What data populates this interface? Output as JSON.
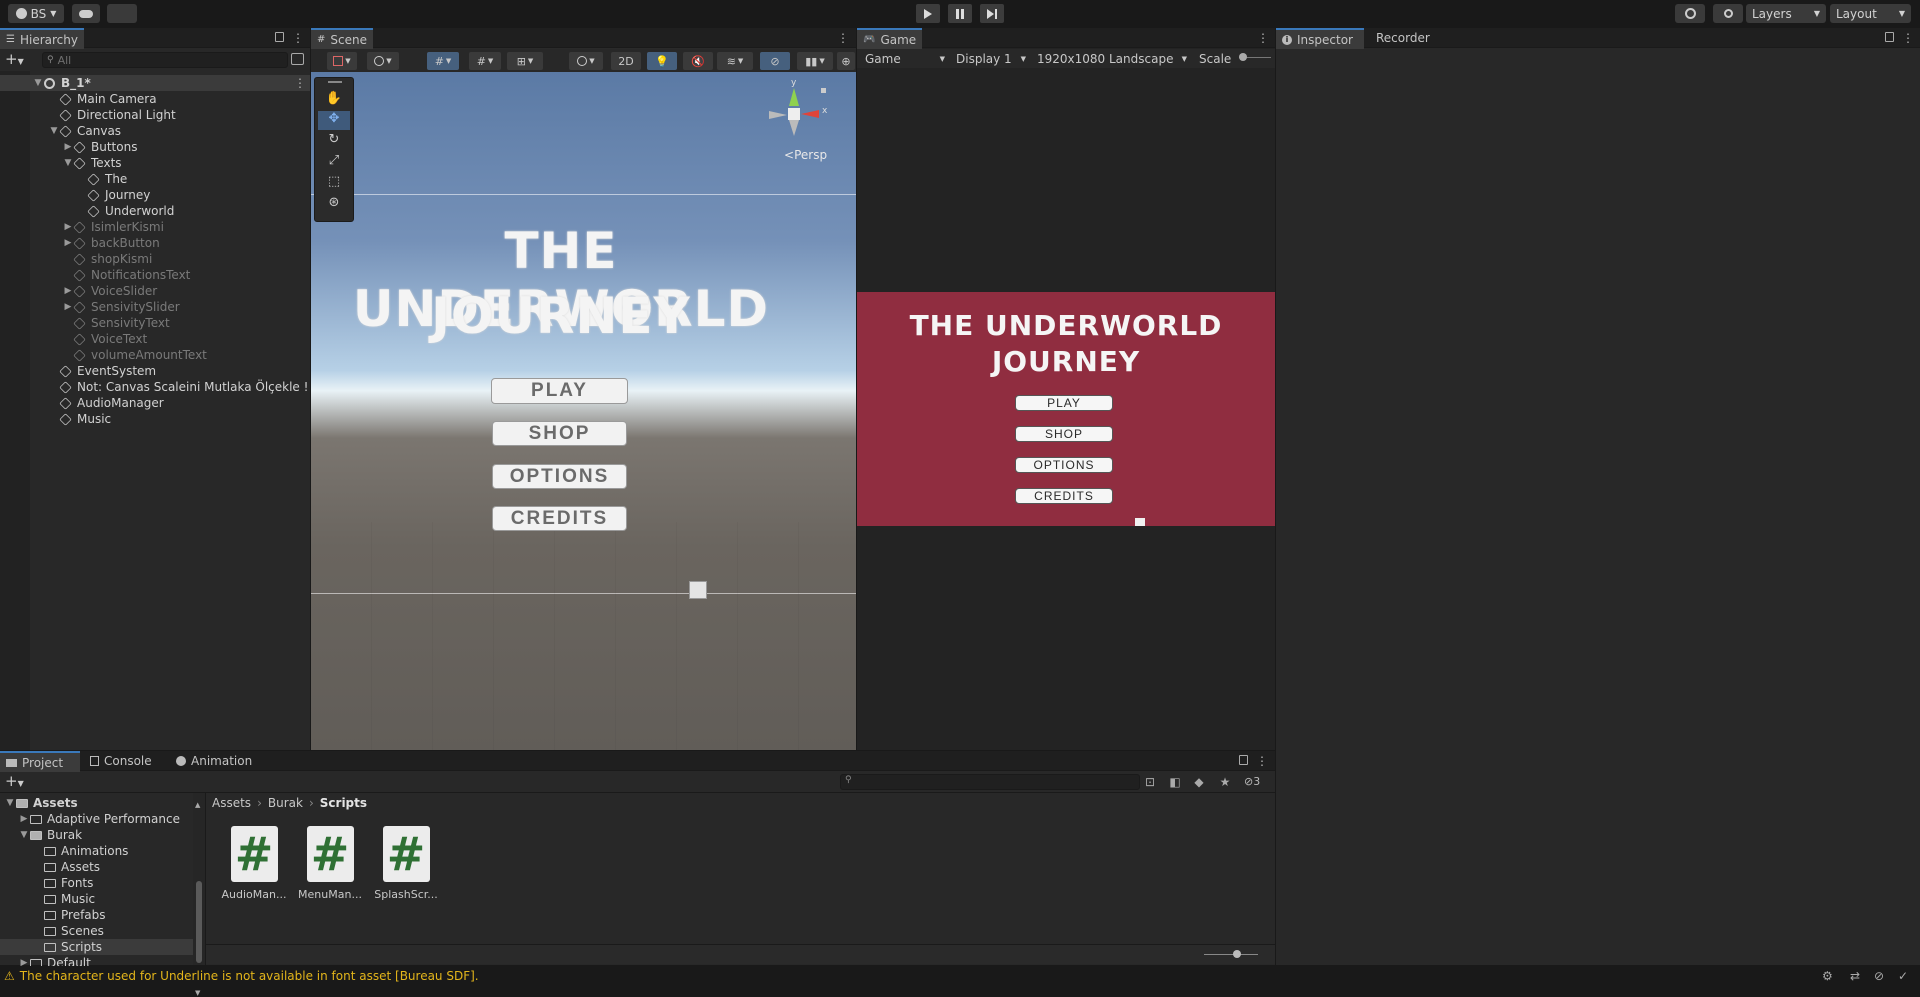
{
  "toolbar": {
    "account": "BS",
    "layers": "Layers",
    "layout": "Layout"
  },
  "hierarchy": {
    "tab": "Hierarchy",
    "search_placeholder": "All",
    "scene": "B_1*",
    "items": [
      {
        "label": "Main Camera",
        "dim": false
      },
      {
        "label": "Directional Light",
        "dim": false
      },
      {
        "label": "Canvas",
        "dim": false
      },
      {
        "label": "Buttons",
        "dim": false
      },
      {
        "label": "Texts",
        "dim": false
      },
      {
        "label": "The",
        "dim": false
      },
      {
        "label": "Journey",
        "dim": false
      },
      {
        "label": "Underworld",
        "dim": false
      },
      {
        "label": "IsimlerKismi",
        "dim": true
      },
      {
        "label": "backButton",
        "dim": true
      },
      {
        "label": "shopKismi",
        "dim": true
      },
      {
        "label": "NotificationsText",
        "dim": true
      },
      {
        "label": "VoiceSlider",
        "dim": true
      },
      {
        "label": "SensivitySlider",
        "dim": true
      },
      {
        "label": "SensivityText",
        "dim": true
      },
      {
        "label": "VoiceText",
        "dim": true
      },
      {
        "label": "volumeAmountText",
        "dim": true
      },
      {
        "label": "EventSystem",
        "dim": false
      },
      {
        "label": "Not: Canvas Scaleini Mutlaka Ölçekle !",
        "dim": false
      },
      {
        "label": "AudioManager",
        "dim": false
      },
      {
        "label": "Music",
        "dim": false
      }
    ]
  },
  "scene": {
    "tab": "Scene",
    "mode_2d": "2D",
    "persp": "Persp",
    "gizmo_y": "y",
    "gizmo_x": "x",
    "title_line1": "THE UNDERWORLD",
    "title_line2": "JOURNEY",
    "buttons": [
      "PLAY",
      "SHOP",
      "OPTIONS",
      "CREDITS"
    ]
  },
  "game": {
    "tab": "Game",
    "mode": "Game",
    "display": "Display 1",
    "resolution": "1920x1080 Landscape",
    "scale": "Scale",
    "title_line1": "THE UNDERWORLD",
    "title_line2": "JOURNEY",
    "buttons": [
      "PLAY",
      "SHOP",
      "OPTIONS",
      "CREDITS"
    ],
    "bg_color": "#902d40"
  },
  "inspector": {
    "tab": "Inspector",
    "recorder_tab": "Recorder"
  },
  "project": {
    "tabs": [
      "Project",
      "Console",
      "Animation"
    ],
    "hidden_count": "3",
    "breadcrumb": [
      "Assets",
      "Burak",
      "Scripts"
    ],
    "tree": [
      {
        "label": "Assets",
        "bold": true
      },
      {
        "label": "Adaptive Performance",
        "bold": false
      },
      {
        "label": "Burak",
        "bold": false
      },
      {
        "label": "Animations",
        "bold": false
      },
      {
        "label": "Assets",
        "bold": false
      },
      {
        "label": "Fonts",
        "bold": false
      },
      {
        "label": "Music",
        "bold": false
      },
      {
        "label": "Prefabs",
        "bold": false
      },
      {
        "label": "Scenes",
        "bold": false
      },
      {
        "label": "Scripts",
        "bold": false
      },
      {
        "label": "Default",
        "bold": false
      }
    ],
    "assets": [
      "AudioMan...",
      "MenuMan...",
      "SplashScr..."
    ]
  },
  "status": {
    "message": "The character used for Underline is not available in font asset [Bureau SDF]."
  }
}
